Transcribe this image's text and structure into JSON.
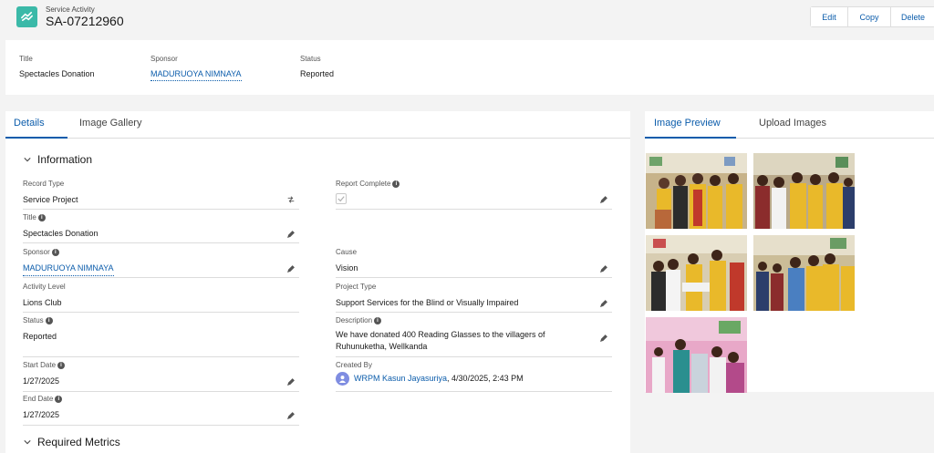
{
  "header": {
    "object_label": "Service Activity",
    "record_name": "SA-07212960",
    "buttons": {
      "edit": "Edit",
      "copy": "Copy",
      "delete": "Delete"
    }
  },
  "highlights": {
    "title_label": "Title",
    "title_value": "Spectacles Donation",
    "sponsor_label": "Sponsor",
    "sponsor_value": "MADURUOYA NIMNAYA",
    "status_label": "Status",
    "status_value": "Reported"
  },
  "left_tabs": {
    "details": "Details",
    "gallery": "Image Gallery"
  },
  "sections": {
    "information": "Information",
    "required_metrics": "Required Metrics"
  },
  "fields": {
    "record_type": {
      "label": "Record Type",
      "value": "Service Project"
    },
    "report_complete": {
      "label": "Report Complete"
    },
    "title": {
      "label": "Title",
      "value": "Spectacles Donation"
    },
    "sponsor": {
      "label": "Sponsor",
      "value": "MADURUOYA NIMNAYA"
    },
    "cause": {
      "label": "Cause",
      "value": "Vision"
    },
    "activity_level": {
      "label": "Activity Level",
      "value": "Lions Club"
    },
    "project_type": {
      "label": "Project Type",
      "value": "Support Services for the Blind or Visually Impaired"
    },
    "status": {
      "label": "Status",
      "value": "Reported"
    },
    "description": {
      "label": "Description",
      "value": "We have donated 400 Reading Glasses to the villagers of Ruhunuketha, Wellkanda"
    },
    "start_date": {
      "label": "Start Date",
      "value": "1/27/2025"
    },
    "created_by": {
      "label": "Created By",
      "user": "WRPM Kasun Jayasuriya",
      "datetime": ", 4/30/2025, 2:43 PM"
    },
    "end_date": {
      "label": "End Date",
      "value": "1/27/2025"
    }
  },
  "right_tabs": {
    "preview": "Image Preview",
    "upload": "Upload Images"
  },
  "colors": {
    "accent": "#0b5cab",
    "icon_teal": "#3bb9a8",
    "lions_yellow": "#e9b92a"
  }
}
